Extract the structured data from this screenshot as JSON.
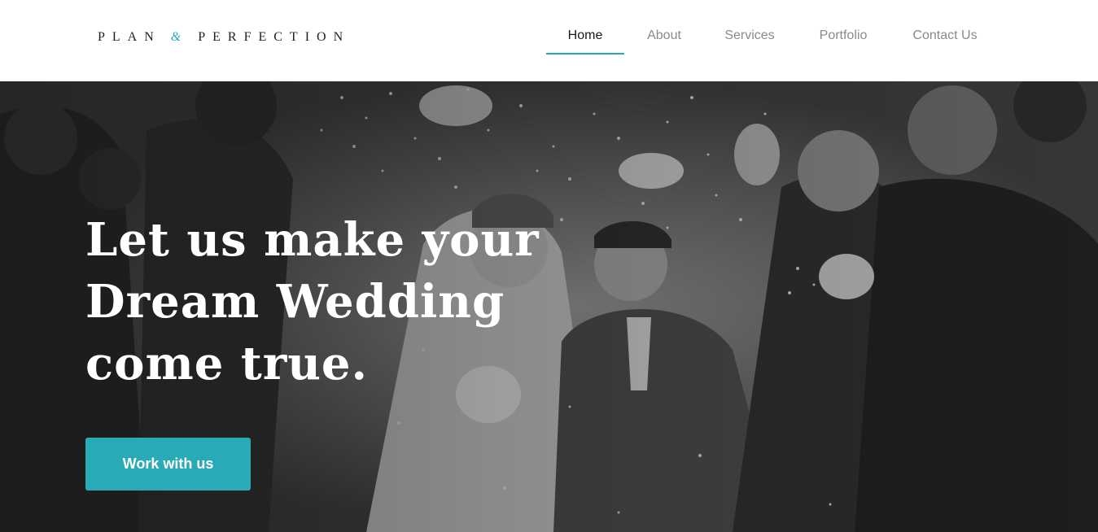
{
  "brand": {
    "logo_left": "PLAN",
    "logo_amp": "&",
    "logo_right": "PERFECTION",
    "accent_color": "#29aab7"
  },
  "nav": {
    "items": [
      {
        "label": "Home",
        "active": true
      },
      {
        "label": "About",
        "active": false
      },
      {
        "label": "Services",
        "active": false
      },
      {
        "label": "Portfolio",
        "active": false
      },
      {
        "label": "Contact Us",
        "active": false
      }
    ]
  },
  "hero": {
    "headline_lines": [
      "Let us make your",
      "Dream Wedding",
      "come true."
    ],
    "cta_label": "Work with us",
    "image_subject": "black-and-white wedding couple walking through confetti surrounded by guests"
  }
}
